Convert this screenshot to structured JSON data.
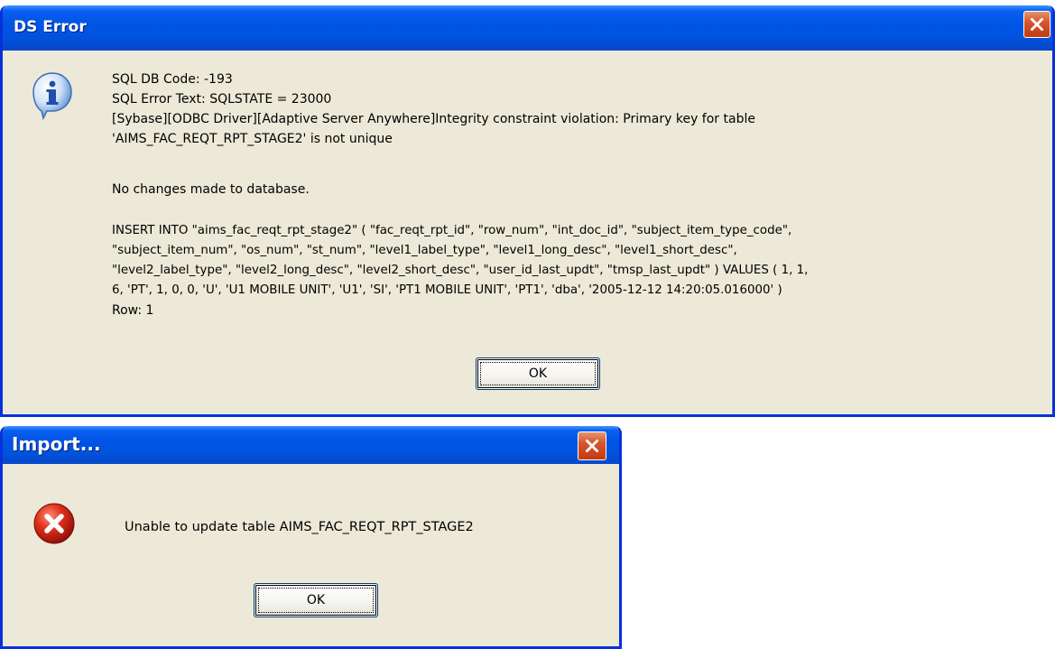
{
  "ds_error_dialog": {
    "title": "DS Error",
    "icon": "information-icon",
    "message_lines": [
      "SQL DB Code: -193",
      "SQL Error Text: SQLSTATE = 23000",
      "[Sybase][ODBC Driver][Adaptive Server Anywhere]Integrity constraint violation: Primary key for table",
      "'AIMS_FAC_REQT_RPT_STAGE2' is not unique",
      "",
      "No changes made to database.",
      "",
      "INSERT INTO \"aims_fac_reqt_rpt_stage2\" ( \"fac_reqt_rpt_id\", \"row_num\", \"int_doc_id\", \"subject_item_type_code\",",
      "\"subject_item_num\", \"os_num\", \"st_num\", \"level1_label_type\", \"level1_long_desc\", \"level1_short_desc\",",
      "\"level2_label_type\", \"level2_long_desc\", \"level2_short_desc\", \"user_id_last_updt\", \"tmsp_last_updt\" ) VALUES ( 1, 1,",
      "6, 'PT', 1, 0, 0, 'U', 'U1 MOBILE UNIT', 'U1', 'SI', 'PT1 MOBILE UNIT', 'PT1', 'dba', '2005-12-12 14:20:05.016000' )",
      "Row: 1"
    ],
    "ok_label": "OK"
  },
  "import_dialog": {
    "title": "Import...",
    "icon": "error-icon",
    "message": "Unable to update table AIMS_FAC_REQT_RPT_STAGE2",
    "ok_label": "OK"
  },
  "colors": {
    "titlebar_blue": "#0055e5",
    "frame_blue": "#0831d9",
    "dialog_bg": "#ece9d8",
    "close_red": "#d7562b"
  }
}
